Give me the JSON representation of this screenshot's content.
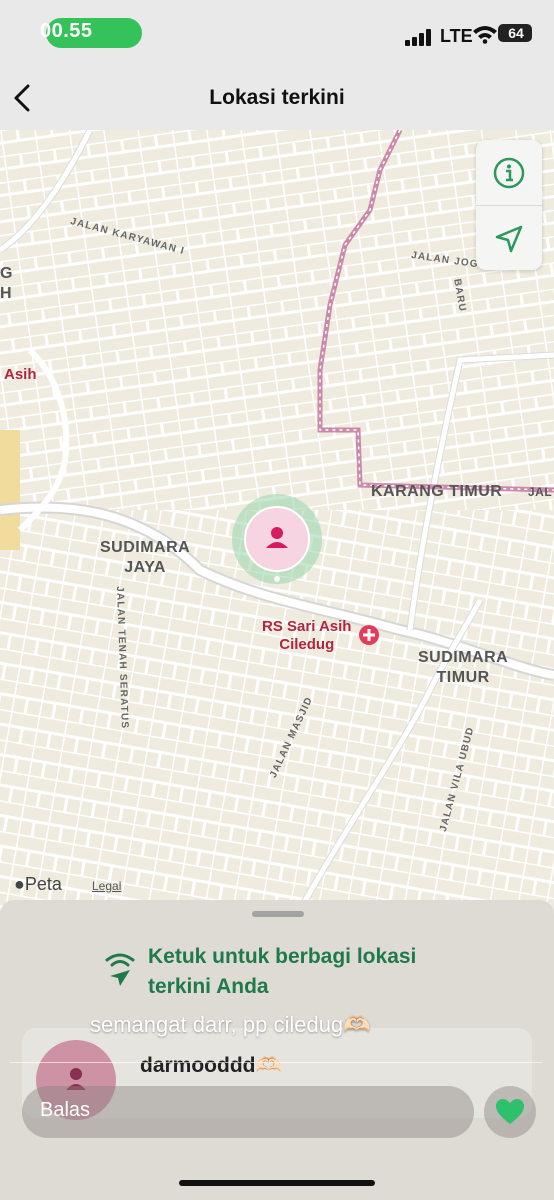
{
  "status_bar": {
    "time": "00.55",
    "network": "LTE",
    "battery": "64"
  },
  "nav": {
    "title": "Lokasi terkini",
    "back_icon": "chevron-left-icon"
  },
  "map": {
    "areas": [
      {
        "id": "sudimara-jaya",
        "label": "SUDIMARA\nJAYA"
      },
      {
        "id": "karang-timur",
        "label": "KARANG TIMUR"
      },
      {
        "id": "sudimara-timur",
        "label": "SUDIMARA\nTIMUR"
      },
      {
        "id": "left-g",
        "label": "G\nH"
      },
      {
        "id": "right-jal",
        "label": "JAL"
      }
    ],
    "streets": [
      {
        "id": "karyawan",
        "label": "JALAN KARYAWAN I"
      },
      {
        "id": "joglo",
        "label": "JALAN JOGLO"
      },
      {
        "id": "baru",
        "label": "BARU"
      },
      {
        "id": "tenah",
        "label": "JALAN TENAH SERATUS"
      },
      {
        "id": "masjid",
        "label": "JALAN MASJID"
      },
      {
        "id": "vila",
        "label": "JALAN VILA UBUD"
      }
    ],
    "pois": [
      {
        "id": "rs-sari-asih",
        "label": "RS Sari Asih\nCiledug"
      },
      {
        "id": "asih-left",
        "label": "Asih"
      }
    ],
    "controls": {
      "info_icon": "info-icon",
      "locate_icon": "location-arrow-icon"
    },
    "attribution": "Peta",
    "legal": "Legal",
    "colors": {
      "accent": "#1f7a4b",
      "pin": "#d81b60",
      "boundary": "#c77ea4",
      "road": "#ffffff",
      "land": "#efebdf"
    }
  },
  "sheet": {
    "share_text": "Ketuk untuk berbagi lokasi\nterkini Anda",
    "share_icon": "location-share-icon"
  },
  "story": {
    "caption": "semangat darr, pp ciledug🫶🏻",
    "author": "darmooddd🫶🏻",
    "reply_placeholder": "Balas",
    "heart_icon": "heart-icon"
  }
}
